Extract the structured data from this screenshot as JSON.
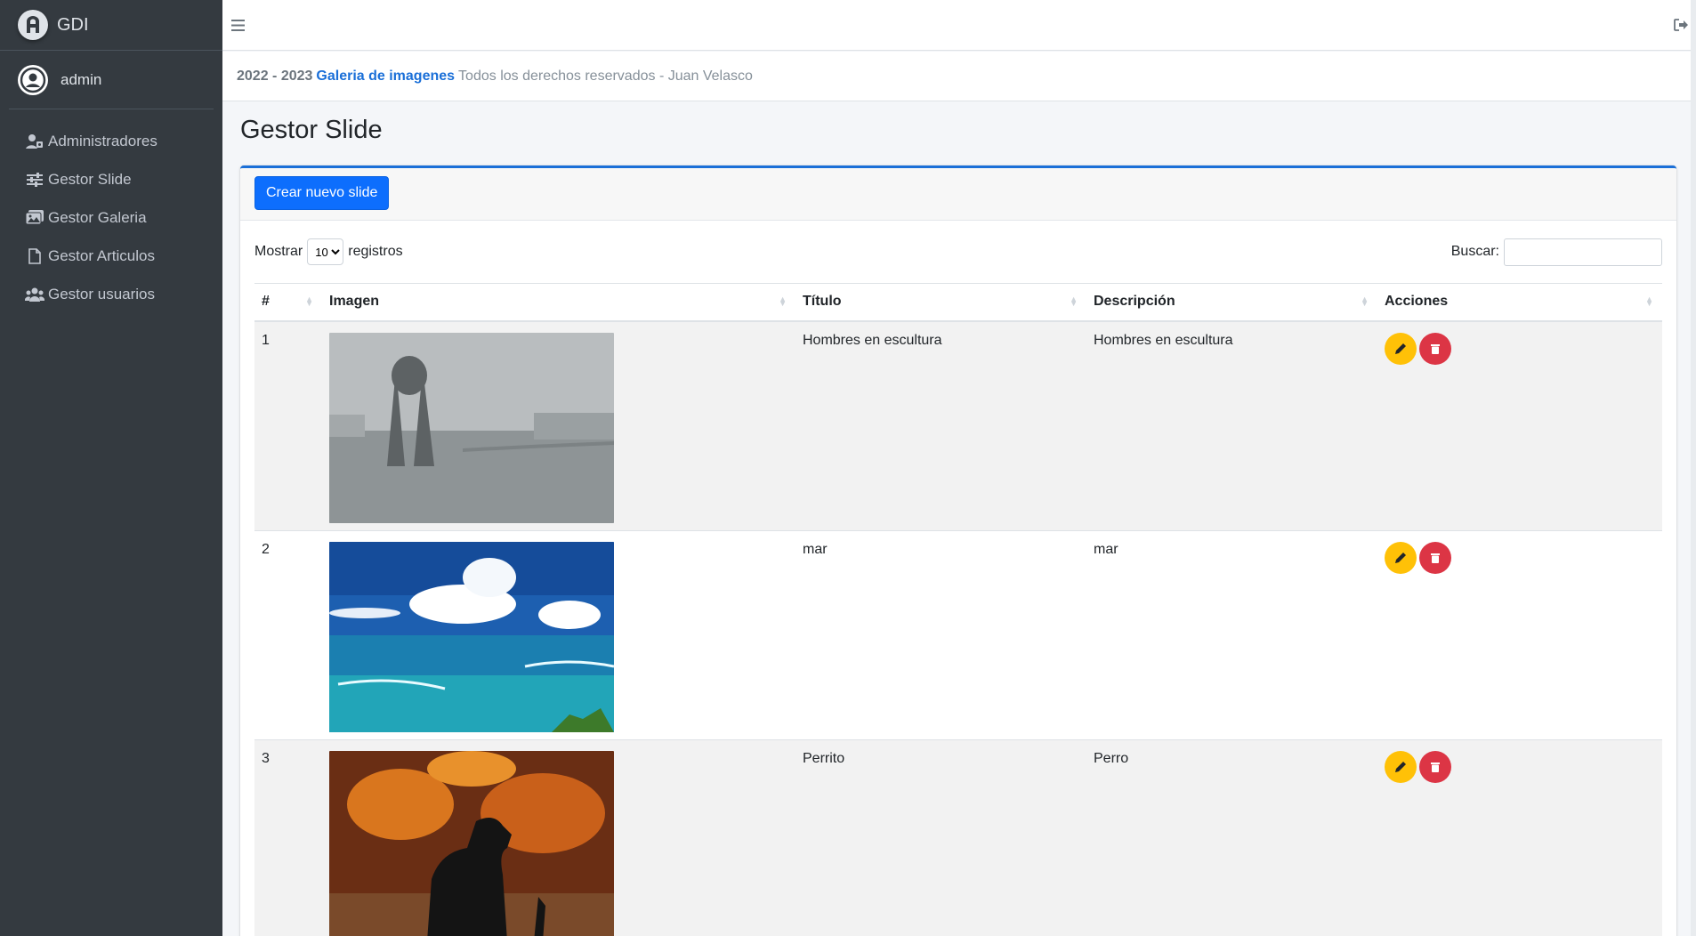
{
  "brand": {
    "name": "GDI",
    "logo_icon": "brand-logo-icon"
  },
  "user": {
    "name": "admin"
  },
  "sidebar": {
    "items": [
      {
        "label": "Administradores",
        "icon": "users-cog-icon"
      },
      {
        "label": "Gestor Slide",
        "icon": "sliders-icon"
      },
      {
        "label": "Gestor Galeria",
        "icon": "images-icon"
      },
      {
        "label": "Gestor Articulos",
        "icon": "file-icon"
      },
      {
        "label": "Gestor usuarios",
        "icon": "users-icon"
      }
    ]
  },
  "footer": {
    "years": "2022 - 2023",
    "site": "Galeria de imagenes",
    "rights": "Todos los derechos reservados - Juan Velasco"
  },
  "page": {
    "title": "Gestor Slide"
  },
  "card": {
    "create_button": "Crear nuevo slide"
  },
  "datatable": {
    "length_prefix": "Mostrar",
    "length_value": "10",
    "length_suffix": "registros",
    "search_label": "Buscar:",
    "search_value": ""
  },
  "table": {
    "headers": [
      "#",
      "Imagen",
      "Título",
      "Descripción",
      "Acciones"
    ],
    "rows": [
      {
        "id": "1",
        "titulo": "Hombres en escultura",
        "descripcion": "Hombres en escultura",
        "image": "sculpture-river-photo"
      },
      {
        "id": "2",
        "titulo": "mar",
        "descripcion": "mar",
        "image": "sea-clouds-photo"
      },
      {
        "id": "3",
        "titulo": "Perrito",
        "descripcion": "Perro",
        "image": "black-dog-photo"
      }
    ]
  },
  "colors": {
    "sidebar_bg": "#343a40",
    "primary": "#0d6efd",
    "edit": "#ffc107",
    "delete": "#dc3545"
  }
}
